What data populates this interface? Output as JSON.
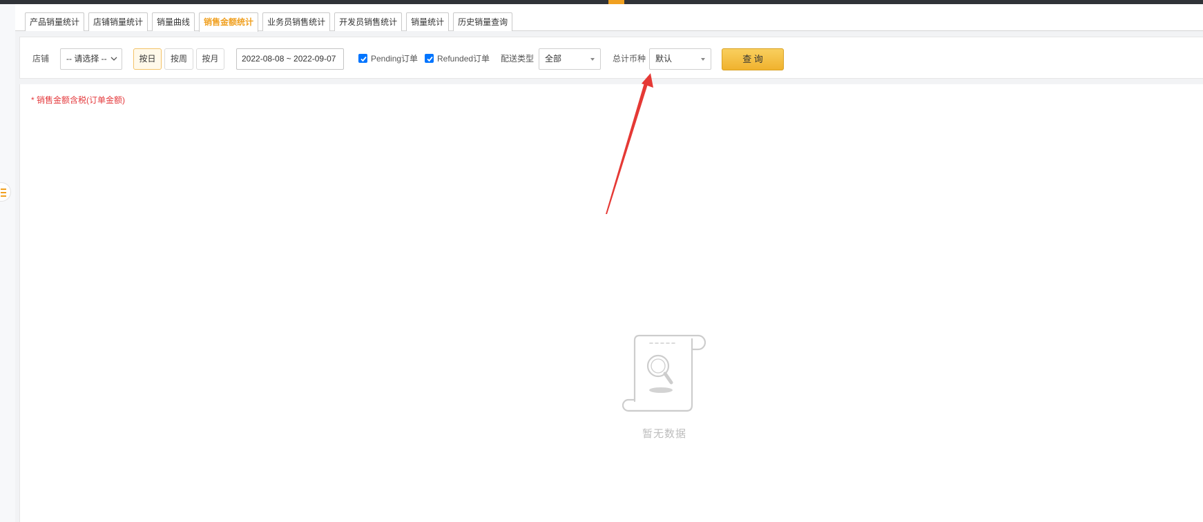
{
  "tabs": [
    {
      "label": "产品销量统计",
      "active": false
    },
    {
      "label": "店铺销量统计",
      "active": false
    },
    {
      "label": "销量曲线",
      "active": false
    },
    {
      "label": "销售金额统计",
      "active": true
    },
    {
      "label": "业务员销售统计",
      "active": false
    },
    {
      "label": "开发员销售统计",
      "active": false
    },
    {
      "label": "销量统计",
      "active": false
    },
    {
      "label": "历史销量查询",
      "active": false
    }
  ],
  "filters": {
    "shop": {
      "label": "店铺",
      "value": "-- 请选择 --"
    },
    "period": {
      "options": [
        {
          "label": "按日",
          "active": true
        },
        {
          "label": "按周",
          "active": false
        },
        {
          "label": "按月",
          "active": false
        }
      ]
    },
    "date_range": "2022-08-08 ~ 2022-09-07",
    "pending": {
      "label": "Pending订单",
      "checked": true
    },
    "refunded": {
      "label": "Refunded订单",
      "checked": true
    },
    "shipping_type": {
      "label": "配送类型",
      "value": "全部"
    },
    "currency": {
      "label": "总计币种",
      "value": "默认"
    },
    "query_button": "查 询"
  },
  "notice": "* 销售金额含税(订单金额)",
  "empty_state": {
    "text": "暂无数据",
    "icon": "empty-document-search-icon"
  },
  "icons": {
    "sidebar_toggle": "menu-icon",
    "select_arrow": "chevron-down-icon",
    "checkbox": "check-icon"
  },
  "colors": {
    "accent": "#f0a020",
    "notice": "#e4393c",
    "checkbox": "#0075ff",
    "query_button": "#f5bd3c",
    "annotation_arrow": "#e53935"
  }
}
